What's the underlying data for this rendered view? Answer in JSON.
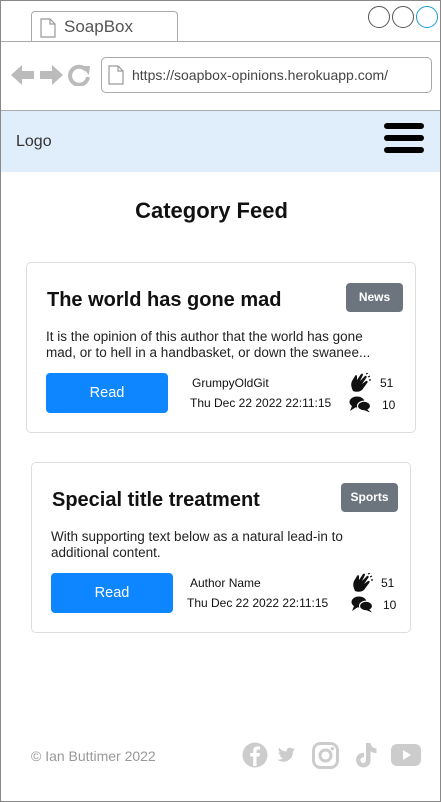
{
  "browser": {
    "tab_title": "SoapBox",
    "url": "https://soapbox-opinions.herokuapp.com/"
  },
  "navbar": {
    "logo": "Logo"
  },
  "page": {
    "title": "Category Feed"
  },
  "posts": [
    {
      "title": "The world has gone mad",
      "category": "News",
      "excerpt": "It is the opinion of this author that the world has gone mad, or to hell in a handbasket, or down the swanee...",
      "read_label": "Read",
      "author": "GrumpyOldGit",
      "date": "Thu Dec 22 2022 22:11:15",
      "claps": "51",
      "comments": "10"
    },
    {
      "title": "Special title treatment",
      "category": "Sports",
      "excerpt": "With supporting text below as a natural lead-in to additional content.",
      "read_label": "Read",
      "author": "Author Name",
      "date": "Thu Dec 22 2022 22:11:15",
      "claps": "51",
      "comments": "10"
    }
  ],
  "footer": {
    "copyright": "© Ian Buttimer 2022",
    "social_icons": [
      "facebook-icon",
      "twitter-icon",
      "instagram-icon",
      "tiktok-icon",
      "youtube-icon"
    ]
  },
  "colors": {
    "navbar_bg": "#e0eefb",
    "primary": "#0d86ff",
    "badge": "#6c757d"
  }
}
